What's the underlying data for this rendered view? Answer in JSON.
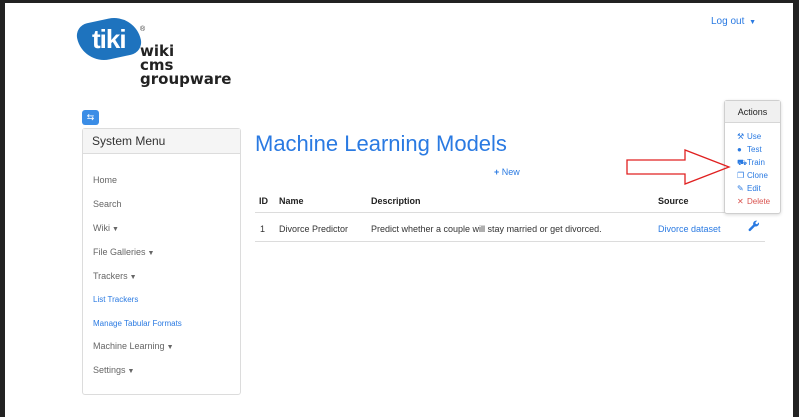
{
  "logo": {
    "badge": "tiki",
    "reg": "®",
    "lines": [
      "wiki",
      "cms",
      "groupware"
    ]
  },
  "header": {
    "logout": "Log out",
    "logout_caret": "▼"
  },
  "system_menu": {
    "title": "System Menu",
    "items": [
      {
        "label": "Home",
        "caret": ""
      },
      {
        "label": "Search",
        "caret": ""
      },
      {
        "label": "Wiki",
        "caret": "▼"
      },
      {
        "label": "File Galleries",
        "caret": "▼"
      },
      {
        "label": "Trackers",
        "caret": "▼"
      },
      {
        "label": "List Trackers",
        "caret": ""
      },
      {
        "label": "Manage Tabular Formats",
        "caret": ""
      },
      {
        "label": "Machine Learning",
        "caret": "▼"
      },
      {
        "label": "Settings",
        "caret": "▼"
      }
    ]
  },
  "main": {
    "title": "Machine Learning Models",
    "new_button": {
      "icon": "+",
      "label": "New"
    }
  },
  "table": {
    "headers": [
      "ID",
      "Name",
      "Description",
      "Source"
    ],
    "rows": [
      {
        "id": "1",
        "name": "Divorce Predictor",
        "description": "Predict whether a couple will stay married or get divorced.",
        "source": "Divorce dataset"
      }
    ]
  },
  "actions": {
    "title": "Actions",
    "items": [
      {
        "label": "Use",
        "icon": "wrench-icon",
        "color": "#2a7ae2"
      },
      {
        "label": "Test",
        "icon": "test-icon",
        "color": "#2a7ae2"
      },
      {
        "label": "Train",
        "icon": "train-icon",
        "color": "#2a7ae2"
      },
      {
        "label": "Clone",
        "icon": "clone-icon",
        "color": "#2a7ae2"
      },
      {
        "label": "Edit",
        "icon": "edit-icon",
        "color": "#2a7ae2"
      },
      {
        "label": "Delete",
        "icon": "delete-icon",
        "color": "#d9534f"
      }
    ]
  },
  "colors": {
    "accent": "#2a7ae2",
    "logo_blue": "#1e73be",
    "annotation_arrow": "#e02020",
    "danger": "#d9534f"
  }
}
